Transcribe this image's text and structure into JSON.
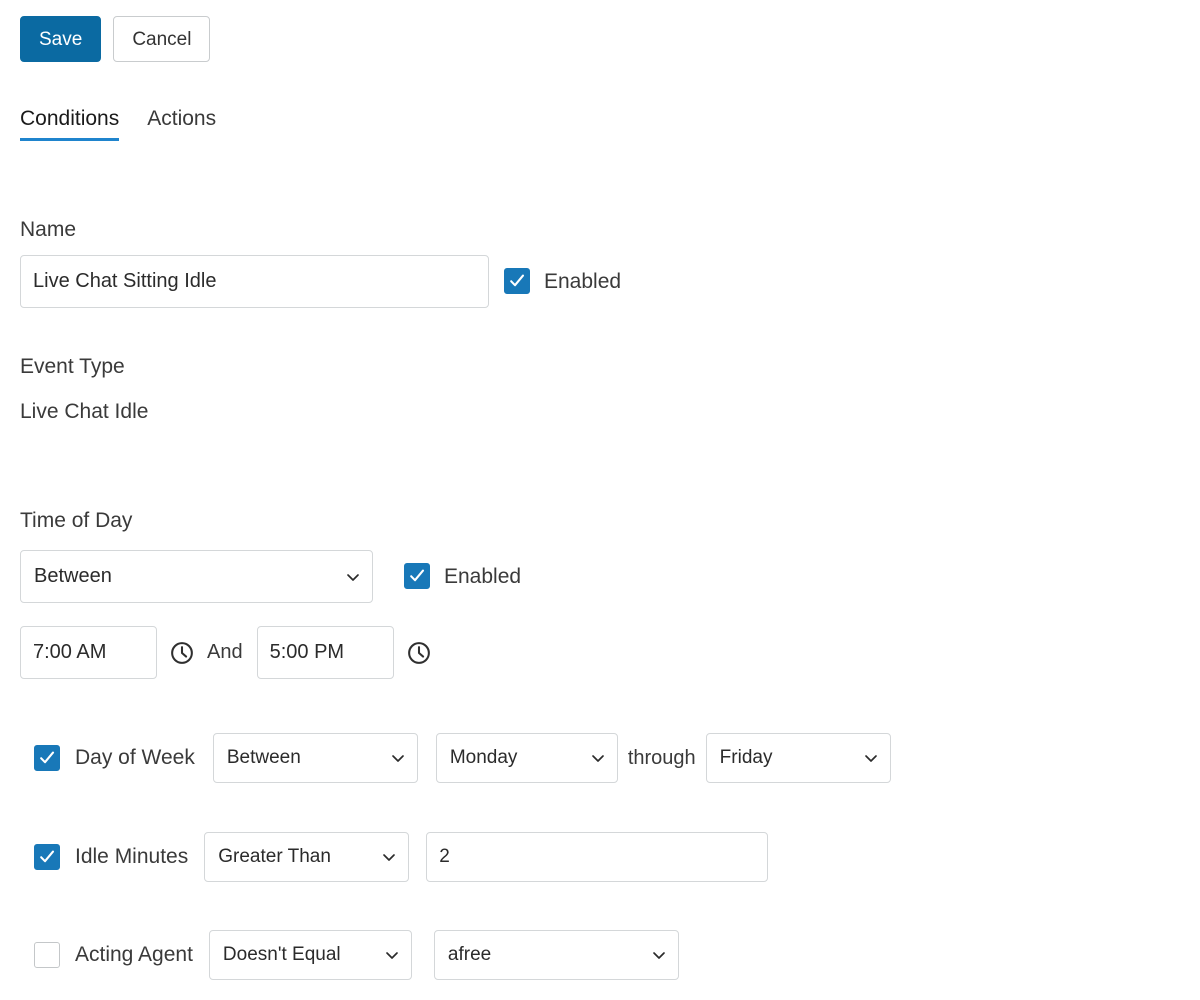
{
  "toolbar": {
    "save_label": "Save",
    "cancel_label": "Cancel"
  },
  "tabs": [
    {
      "label": "Conditions",
      "active": true
    },
    {
      "label": "Actions",
      "active": false
    }
  ],
  "form": {
    "name": {
      "label": "Name",
      "value": "Live Chat Sitting Idle",
      "placeholder": "",
      "enabled_label": "Enabled",
      "enabled_checked": true
    },
    "event_type": {
      "label": "Event Type",
      "value": "Live Chat Idle"
    },
    "time_of_day": {
      "label": "Time of Day",
      "operator": "Between",
      "enabled_label": "Enabled",
      "enabled_checked": true,
      "start_time": "7:00 AM",
      "end_time": "5:00 PM",
      "conjunction": "And",
      "start_icon": "clock-icon",
      "end_icon": "clock-icon"
    },
    "day_of_week": {
      "label": "Day of Week",
      "checked": true,
      "operator": "Between",
      "from_value": "Monday",
      "connector": "through",
      "to_value": "Friday"
    },
    "idle_minutes": {
      "label": "Idle Minutes",
      "checked": true,
      "operator": "Greater Than",
      "value": "2",
      "placeholder": ""
    },
    "acting_agent": {
      "label": "Acting Agent",
      "checked": false,
      "operator": "Doesn't Equal",
      "value": "afree"
    }
  },
  "colors": {
    "primary_blue": "#0b6aa2",
    "checkbox_blue": "#1878b8",
    "tab_underline": "#1f84cd",
    "border_gray": "#d4d7d9",
    "text_dark": "#333333"
  },
  "icons": {
    "chevron_down": "chevron-down-icon",
    "clock": "clock-icon",
    "check": "check-icon"
  }
}
